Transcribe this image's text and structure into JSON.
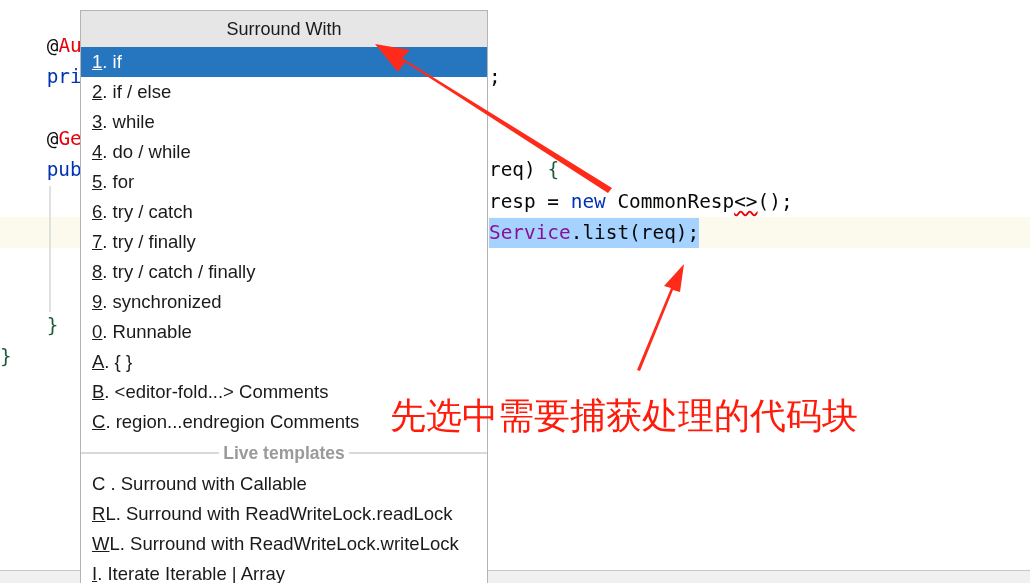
{
  "editor": {
    "lines": [
      {
        "kind": "code",
        "left": [
          {
            "text": "    @",
            "kind": "plain"
          },
          {
            "text": "Au",
            "kind": "annotation"
          }
        ]
      },
      {
        "kind": "code",
        "left": [
          {
            "text": "    pri",
            "kind": "keyword"
          }
        ],
        "right": [
          {
            "text": ";",
            "kind": "plain"
          }
        ]
      },
      {
        "kind": "blank"
      },
      {
        "kind": "code",
        "left": [
          {
            "text": "    @",
            "kind": "plain"
          },
          {
            "text": "Ge",
            "kind": "annotation"
          }
        ]
      },
      {
        "kind": "code",
        "left": [
          {
            "text": "    pub",
            "kind": "keyword"
          }
        ],
        "right": [
          {
            "text": "req) ",
            "kind": "plain"
          },
          {
            "text": "{",
            "kind": "brace"
          }
        ]
      },
      {
        "kind": "code",
        "right": [
          {
            "text": "resp = ",
            "kind": "plain"
          },
          {
            "text": "new",
            "kind": "keyword"
          },
          {
            "text": " CommonResp",
            "kind": "plain"
          },
          {
            "text": "<>",
            "kind": "error"
          },
          {
            "text": "();",
            "kind": "plain"
          }
        ]
      },
      {
        "kind": "code",
        "right": [
          {
            "text": "Service",
            "kind": "field"
          },
          {
            "text": ".list(req);",
            "kind": "plain"
          }
        ],
        "current": true,
        "selected": true
      },
      {
        "kind": "blank"
      },
      {
        "kind": "blank"
      },
      {
        "kind": "code",
        "left": [
          {
            "text": "    }",
            "kind": "brace"
          }
        ]
      },
      {
        "kind": "code",
        "left": [
          {
            "text": "}",
            "kind": "brace"
          }
        ]
      }
    ]
  },
  "popup": {
    "title": "Surround With",
    "items": [
      {
        "kind": "item",
        "mnemonic": "1",
        "text": ". if",
        "selected": true
      },
      {
        "kind": "item",
        "mnemonic": "2",
        "text": ". if / else",
        "selected": false
      },
      {
        "kind": "item",
        "mnemonic": "3",
        "text": ". while",
        "selected": false
      },
      {
        "kind": "item",
        "mnemonic": "4",
        "text": ". do / while",
        "selected": false
      },
      {
        "kind": "item",
        "mnemonic": "5",
        "text": ". for",
        "selected": false
      },
      {
        "kind": "item",
        "mnemonic": "6",
        "text": ". try / catch",
        "selected": false
      },
      {
        "kind": "item",
        "mnemonic": "7",
        "text": ". try / finally",
        "selected": false
      },
      {
        "kind": "item",
        "mnemonic": "8",
        "text": ". try / catch / finally",
        "selected": false
      },
      {
        "kind": "item",
        "mnemonic": "9",
        "text": ". synchronized",
        "selected": false
      },
      {
        "kind": "item",
        "mnemonic": "0",
        "text": ". Runnable",
        "selected": false
      },
      {
        "kind": "item",
        "mnemonic": "A",
        "text": ". { }",
        "selected": false
      },
      {
        "kind": "item",
        "mnemonic": "B",
        "text": ". <editor-fold...> Comments",
        "selected": false
      },
      {
        "kind": "item",
        "mnemonic": "C",
        "text": ". region...endregion Comments",
        "selected": false
      },
      {
        "kind": "separator",
        "text": "Live templates"
      },
      {
        "kind": "item",
        "text": "C . Surround with Callable",
        "selected": false
      },
      {
        "kind": "item",
        "mnemonic": "R",
        "text": "L. Surround with ReadWriteLock.readLock",
        "selected": false
      },
      {
        "kind": "item",
        "mnemonic": "W",
        "text": "L. Surround with ReadWriteLock.writeLock",
        "selected": false
      },
      {
        "kind": "item",
        "mnemonic": "I",
        "text": ". Iterate Iterable | Array",
        "selected": false
      }
    ]
  },
  "annotation": {
    "text": "先选中需要捕获处理的代码块"
  }
}
